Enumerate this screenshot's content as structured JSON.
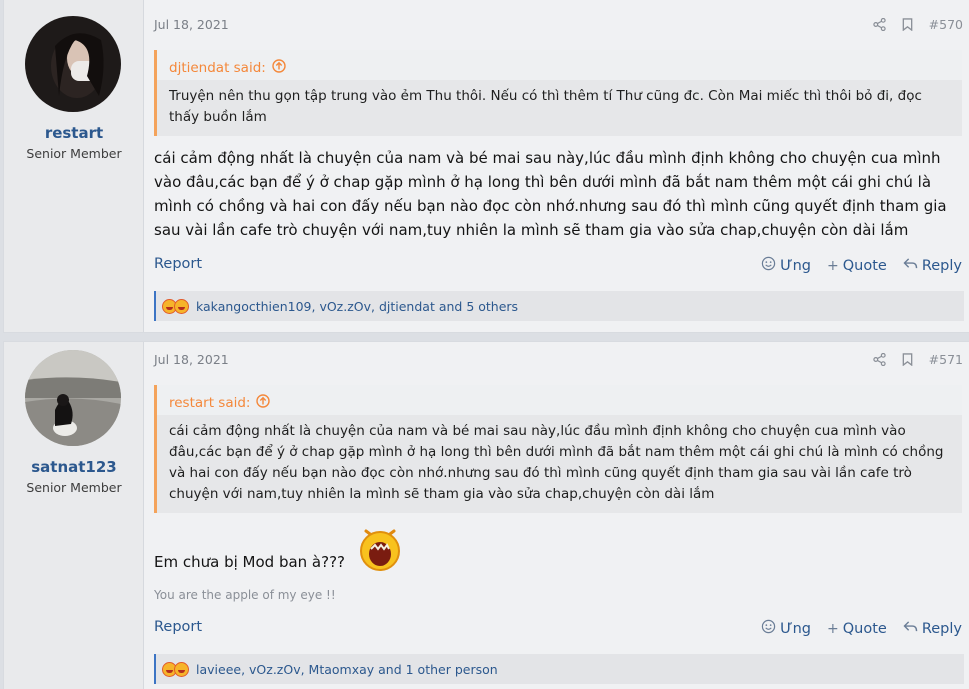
{
  "posts": [
    {
      "user": {
        "name": "restart",
        "title": "Senior Member"
      },
      "date": "Jul 18, 2021",
      "number": "#570",
      "quote": {
        "author": "djtiendat said:",
        "text": "Truyện nên thu gọn tập trung vào ẻm Thu thôi. Nếu có thì thêm tí Thư cũng đc. Còn Mai miếc thì thôi bỏ đi, đọc thấy buồn lắm"
      },
      "body": "cái cảm động nhất là chuyện của nam và bé mai sau này,lúc đầu mình định không cho chuyện cua mình vào đâu,các bạn để ý ở chap gặp mình ở hạ long thì bên dưới mình đã bắt nam thêm một cái ghi chú là mình có chồng và hai con đấy nếu bạn nào đọc còn nhớ.nhưng sau đó thì mình cũng quyết định tham gia sau vài lần cafe trò chuyện với nam,tuy nhiên la mình sẽ tham gia vào sửa chap,chuyện còn dài lắm",
      "actions": {
        "report": "Report",
        "like": "Ưng",
        "quote": "Quote",
        "reply": "Reply"
      },
      "reactions": "kakangocthien109, vOz.zOv, djtiendat and 5 others"
    },
    {
      "user": {
        "name": "satnat123",
        "title": "Senior Member"
      },
      "date": "Jul 18, 2021",
      "number": "#571",
      "quote": {
        "author": "restart said:",
        "text": "cái cảm động nhất là chuyện của nam và bé mai sau này,lúc đầu mình định không cho chuyện cua mình vào đâu,các bạn để ý ở chap gặp mình ở hạ long thì bên dưới mình đã bắt nam thêm một cái ghi chú là mình có chồng và hai con đấy nếu bạn nào đọc còn nhớ.nhưng sau đó thì mình cũng quyết định tham gia sau vài lần cafe trò chuyện với nam,tuy nhiên la mình sẽ tham gia vào sửa chap,chuyện còn dài lắm"
      },
      "body": "Em chưa bị Mod ban à???",
      "signature": "You are the apple of my eye !!",
      "actions": {
        "report": "Report",
        "like": "Ưng",
        "quote": "Quote",
        "reply": "Reply"
      },
      "reactions": "lavieee, vOz.zOv, Mtaomxay and 1 other person"
    }
  ],
  "icons": [
    "share-icon",
    "bookmark-icon",
    "arrow-up-circle-icon",
    "smile-icon",
    "plus-icon",
    "reply-icon",
    "crying-emoji-icon"
  ],
  "colors": {
    "username": "#2c588e",
    "quote_accent": "#f4a35b",
    "link": "#2c588e"
  }
}
